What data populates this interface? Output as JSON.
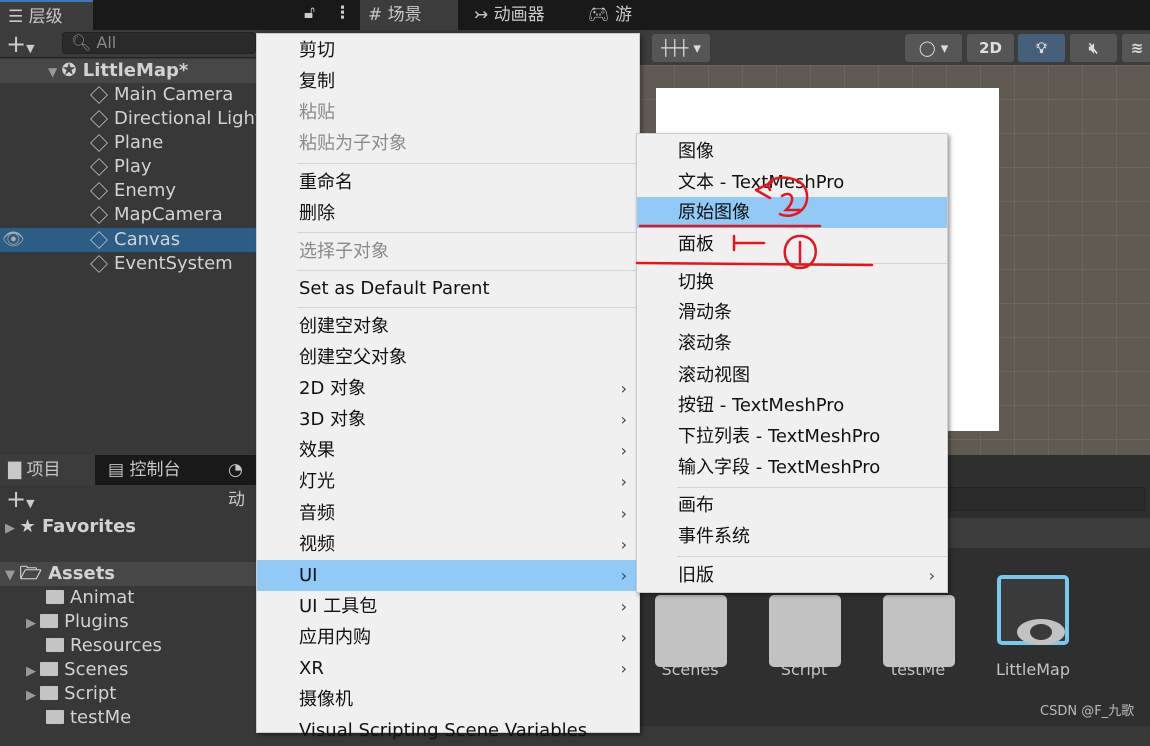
{
  "tabs": {
    "hierarchy": "层级",
    "scene": "场景",
    "animator": "动画器",
    "game": "游戏"
  },
  "hierarchy": {
    "search_placeholder": "All",
    "root": "LittleMap*",
    "items": [
      "Main Camera",
      "Directional Light",
      "Plane",
      "Play",
      "Enemy",
      "MapCamera",
      "Canvas",
      "EventSystem"
    ],
    "selected": "Canvas"
  },
  "scene_toolbar": {
    "mode_2d": "2D"
  },
  "project": {
    "tabs": [
      "项目",
      "控制台",
      "动"
    ],
    "favorites": "Favorites",
    "assets": "Assets",
    "folders": [
      "Animat",
      "Plugins",
      "Resources",
      "Scenes",
      "Script",
      "testMe"
    ],
    "grid_items": [
      "Scenes",
      "Script",
      "testMe",
      "LittleMap"
    ]
  },
  "context_menu": {
    "items": [
      "剪切",
      "复制",
      "粘贴",
      "粘贴为子对象",
      "重命名",
      "删除",
      "选择子对象",
      "Set as Default Parent",
      "创建空对象",
      "创建空父对象",
      "2D 对象",
      "3D 对象",
      "效果",
      "灯光",
      "音频",
      "视频",
      "UI",
      "UI 工具包",
      "应用内购",
      "XR",
      "摄像机",
      "Visual Scripting Scene Variables"
    ],
    "highlighted": "UI"
  },
  "ui_submenu": {
    "items": [
      "图像",
      "文本 - TextMeshPro",
      "原始图像",
      "面板",
      "切换",
      "滑动条",
      "滚动条",
      "滚动视图",
      "按钮 - TextMeshPro",
      "下拉列表 - TextMeshPro",
      "输入字段 - TextMeshPro",
      "画布",
      "事件系统",
      "旧版"
    ],
    "highlighted": "原始图像"
  },
  "annotations": {
    "color": "#e8141c"
  },
  "watermark": "CSDN @F_九歌"
}
